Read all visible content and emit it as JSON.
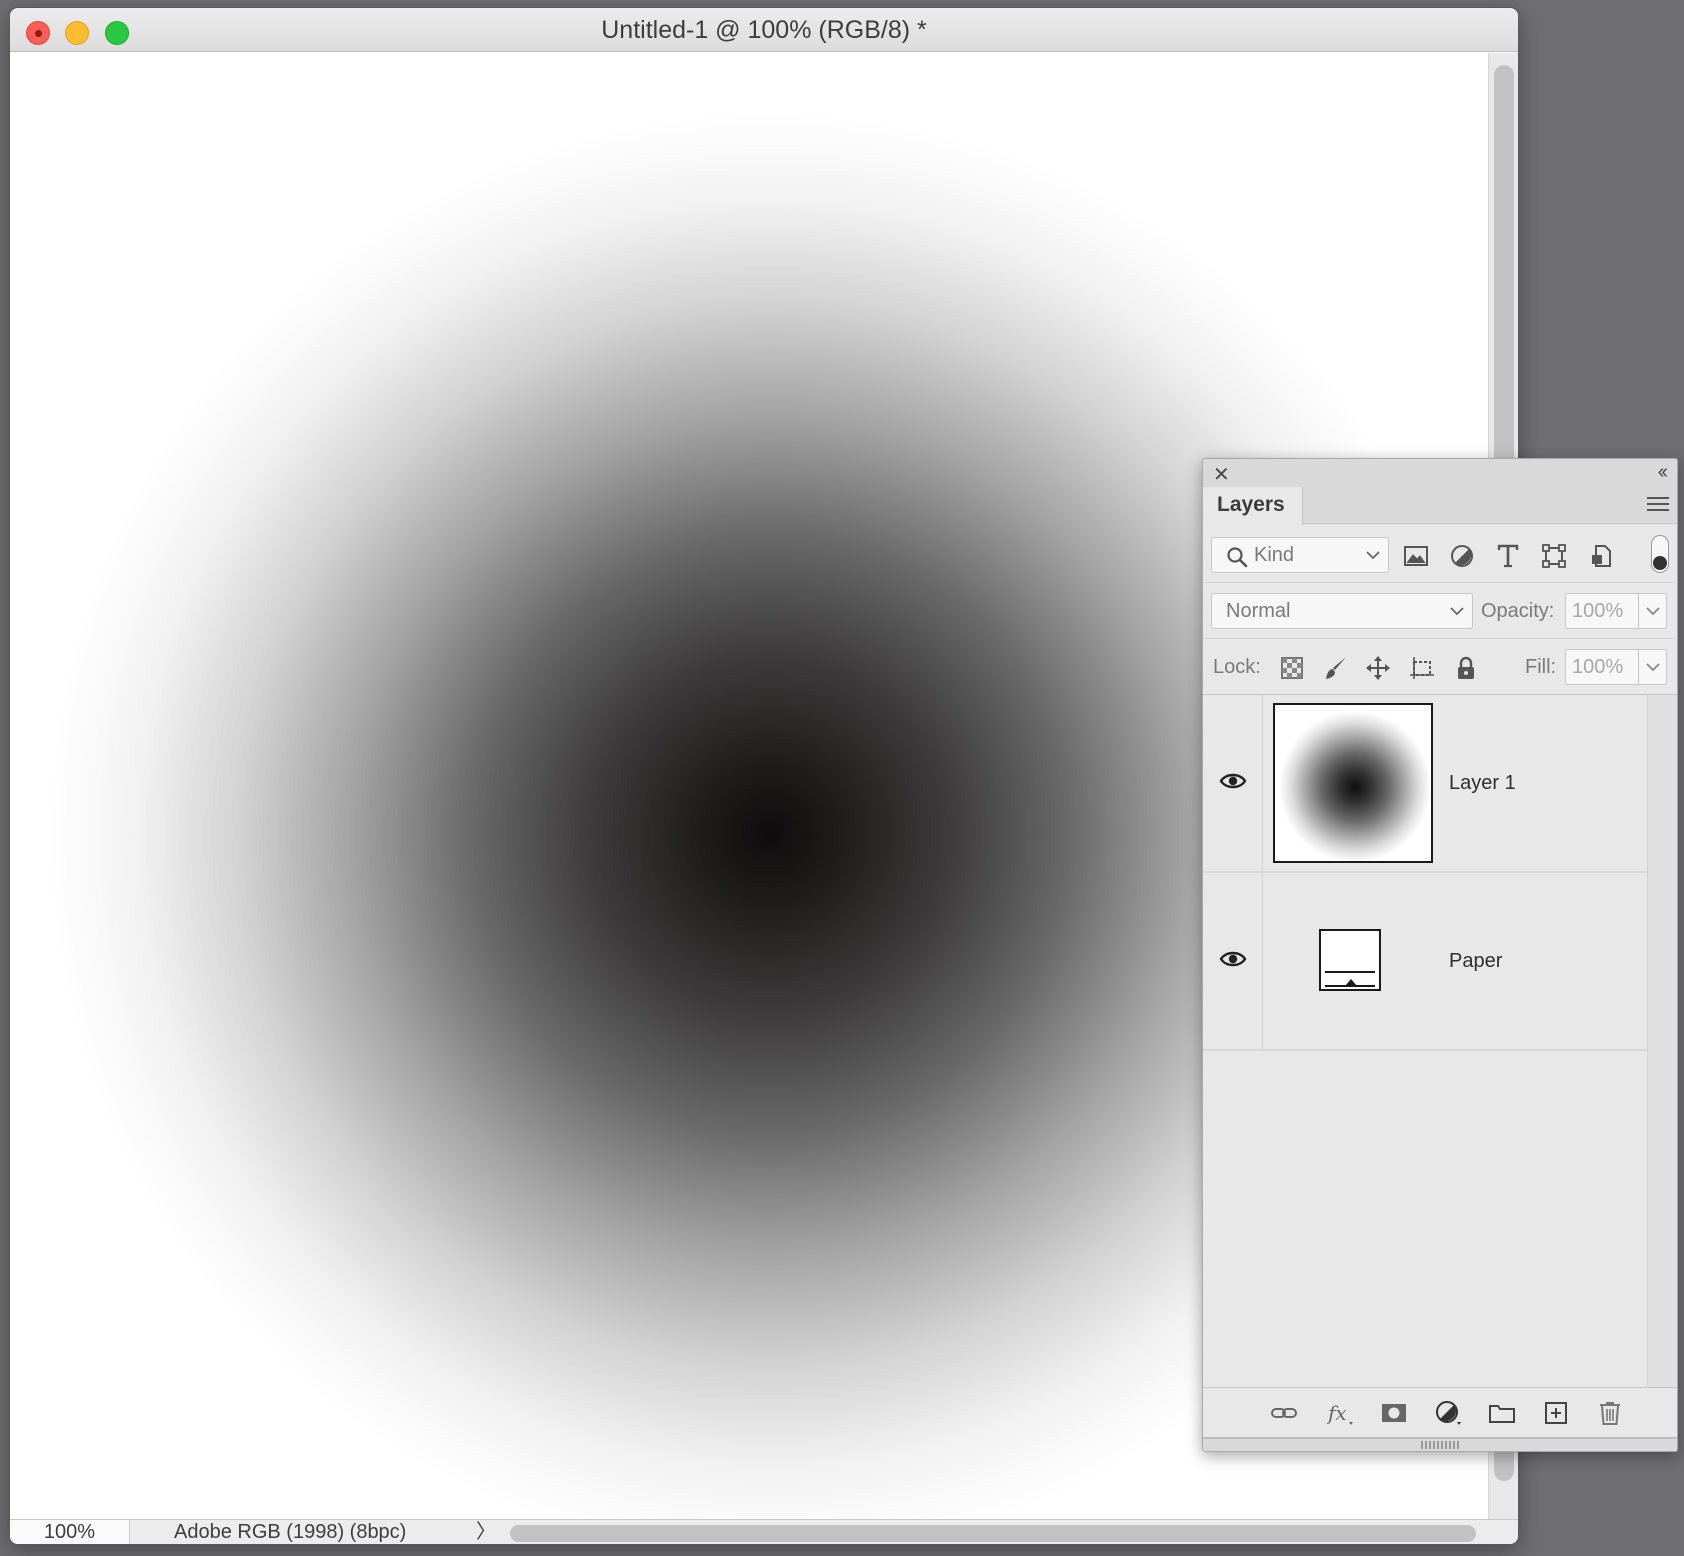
{
  "window": {
    "title": "Untitled-1 @ 100% (RGB/8) *"
  },
  "status_bar": {
    "zoom": "100%",
    "doc_info": "Adobe RGB (1998) (8bpc)",
    "info_arrow": "〉"
  },
  "layers_panel": {
    "close_glyph": "✕",
    "collapse_glyph": "‹‹",
    "tab_label": "Layers",
    "filter": {
      "kind_placeholder": "Kind",
      "icons": [
        "pixel-layer-filter-icon",
        "adjustment-layer-filter-icon",
        "type-layer-filter-icon",
        "shape-layer-filter-icon",
        "smart-object-filter-icon"
      ]
    },
    "blend_mode": "Normal",
    "opacity_label": "Opacity:",
    "opacity_value": "100%",
    "lock_label": "Lock:",
    "fill_label": "Fill:",
    "fill_value": "100%",
    "layers": [
      {
        "name": "Layer 1",
        "visible": true
      },
      {
        "name": "Paper",
        "visible": true
      }
    ],
    "bottom_icons": [
      "link-layers-icon",
      "fx-icon",
      "add-mask-icon",
      "adjustment-layer-icon",
      "new-group-icon",
      "new-layer-icon",
      "delete-layer-icon"
    ]
  },
  "colors": {
    "close": "#ff5f57",
    "minimize": "#febc2e",
    "maximize": "#28c840"
  }
}
